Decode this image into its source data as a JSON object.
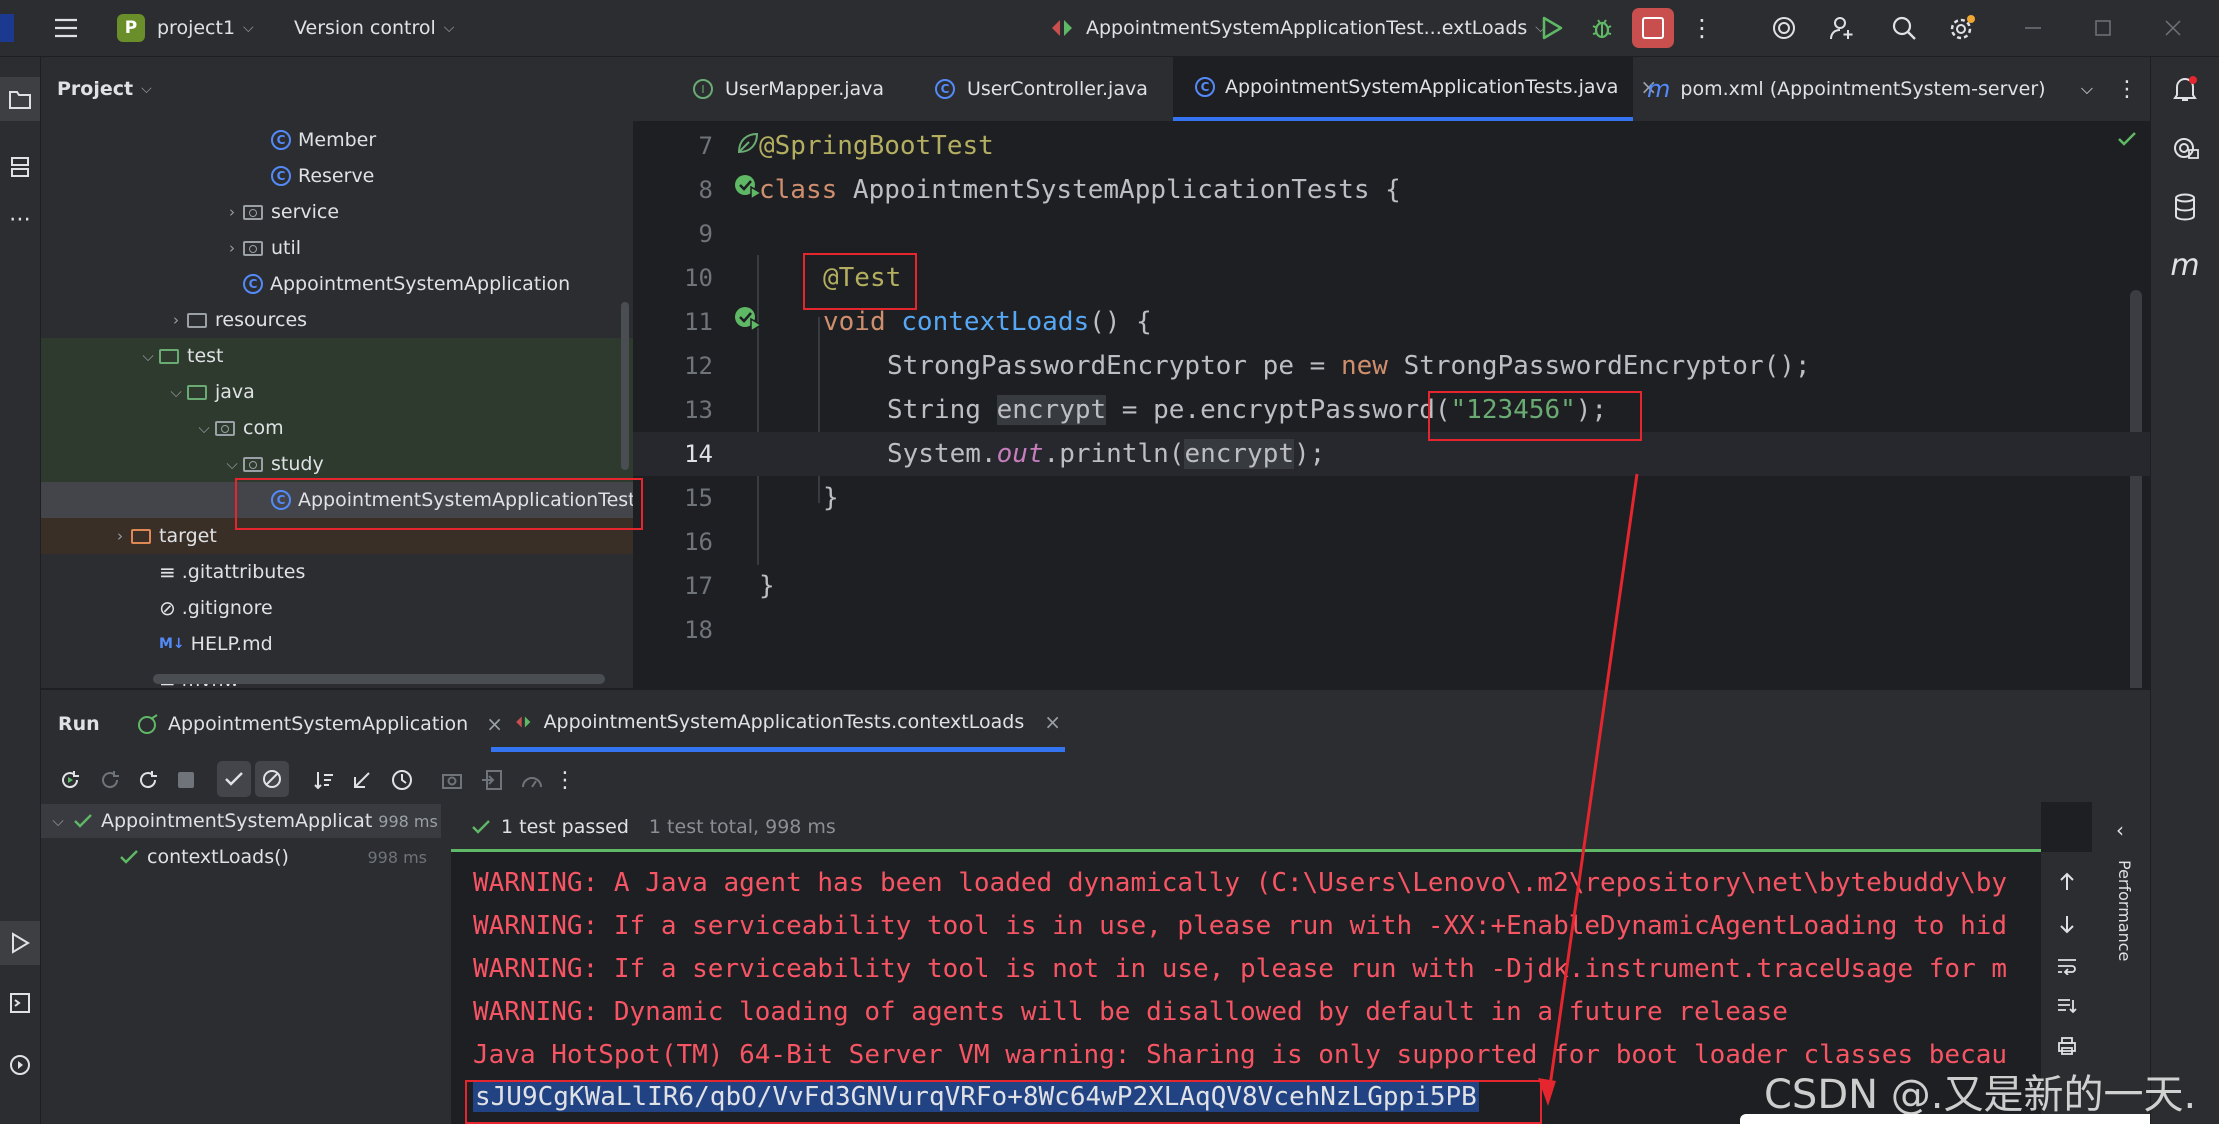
{
  "titlebar": {
    "project_badge": "P",
    "project_name": "project1",
    "version_control": "Version control",
    "run_config": "AppointmentSystemApplicationTest...extLoads"
  },
  "project_panel": {
    "title": "Project",
    "tree": [
      {
        "label": "Member",
        "type": "class",
        "indent": 5
      },
      {
        "label": "Reserve",
        "type": "class",
        "indent": 5
      },
      {
        "label": "service",
        "type": "package",
        "indent": 4,
        "chevron": "right"
      },
      {
        "label": "util",
        "type": "package",
        "indent": 4,
        "chevron": "right"
      },
      {
        "label": "AppointmentSystemApplication",
        "type": "app",
        "indent": 4
      },
      {
        "label": "resources",
        "type": "folder",
        "indent": 2,
        "chevron": "right"
      },
      {
        "label": "test",
        "type": "folder",
        "indent": 1,
        "chevron": "down"
      },
      {
        "label": "java",
        "type": "folder",
        "indent": 2,
        "chevron": "down"
      },
      {
        "label": "com",
        "type": "package",
        "indent": 3,
        "chevron": "down"
      },
      {
        "label": "study",
        "type": "package",
        "indent": 4,
        "chevron": "down"
      },
      {
        "label": "AppointmentSystemApplicationTests",
        "type": "app",
        "indent": 5,
        "selected": true
      },
      {
        "label": "target",
        "type": "folder",
        "indent": 0,
        "chevron": "right",
        "orange": true
      },
      {
        "label": ".gitattributes",
        "type": "file",
        "indent": 1
      },
      {
        "label": ".gitignore",
        "type": "ignore",
        "indent": 1
      },
      {
        "label": "HELP.md",
        "type": "md",
        "indent": 1
      },
      {
        "label": "mvnw",
        "type": "file",
        "indent": 1
      }
    ]
  },
  "editor_tabs": [
    {
      "label": "UserMapper.java",
      "icon": "I"
    },
    {
      "label": "UserController.java",
      "icon": "C"
    },
    {
      "label": "AppointmentSystemApplicationTests.java",
      "icon": "C",
      "active": true,
      "close": "×"
    },
    {
      "label": "pom.xml (AppointmentSystem-server)",
      "icon": "m"
    }
  ],
  "code": {
    "line_numbers": [
      "7",
      "8",
      "9",
      "10",
      "11",
      "12",
      "13",
      "14",
      "15",
      "16",
      "17",
      "18"
    ],
    "l7": "@SpringBootTest",
    "l8_kw": "class",
    "l8_name": " AppointmentSystemApplicationTests {",
    "l10": "@Test",
    "l11_kw": "void",
    "l11_fn": "contextLoads",
    "l11_rest": "() {",
    "l12_a": "StrongPasswordEncryptor pe = ",
    "l12_kw": "new",
    "l12_b": " StrongPasswordEncryptor();",
    "l13_a": "String ",
    "l13_var": "encrypt",
    "l13_b": " = pe.encryptPassword(",
    "l13_str": "\"123456\"",
    "l13_c": ");",
    "l14_a": "System.",
    "l14_it": "out",
    "l14_b": ".println(",
    "l14_var": "encrypt",
    "l14_c": ");",
    "l15": "}",
    "l17": "}"
  },
  "run_panel": {
    "title": "Run",
    "tab1": "AppointmentSystemApplication",
    "tab2": "AppointmentSystemApplicationTests.contextLoads",
    "close": "×",
    "tree_root": "AppointmentSystemApplicat",
    "tree_root_time": "998 ms",
    "tree_child": "contextLoads()",
    "tree_child_time": "998 ms",
    "status_passed": "1 test passed",
    "status_total": "1 test total, 998 ms",
    "console": [
      "WARNING: A Java agent has been loaded dynamically (C:\\Users\\Lenovo\\.m2\\repository\\net\\bytebuddy\\by",
      "WARNING: If a serviceability tool is in use, please run with -XX:+EnableDynamicAgentLoading to hid",
      "WARNING: If a serviceability tool is not in use, please run with -Djdk.instrument.traceUsage for m",
      "WARNING: Dynamic loading of agents will be disallowed by default in a future release",
      "Java HotSpot(TM) 64-Bit Server VM warning: Sharing is only supported for boot loader classes becau"
    ],
    "output": "sJU9CgKWaLlIR6/qbO/VvFd3GNVurqVRFo+8Wc64wP2XLAqQV8VcehNzLGppi5PB"
  },
  "perf_label": "Performance",
  "watermark": "CSDN @.又是新的一天.",
  "colors": {
    "accent_red": "#e5262e",
    "stop_red": "#c94f4f",
    "run_green": "#5fb865",
    "selection_blue": "#214283"
  }
}
